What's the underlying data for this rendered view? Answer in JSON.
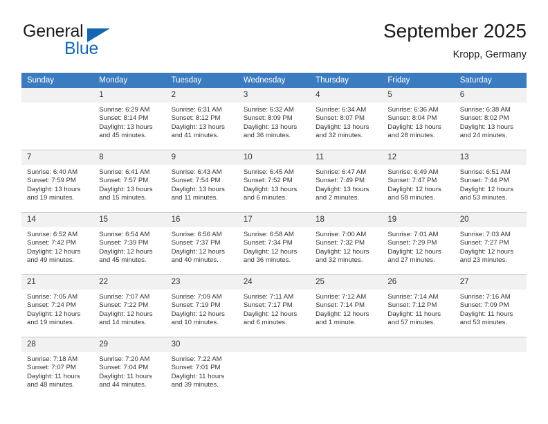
{
  "brand": {
    "name_part1": "General",
    "name_part2": "Blue",
    "accent_color": "#1567b2"
  },
  "header": {
    "title": "September 2025",
    "subtitle": "Kropp, Germany",
    "header_bg_color": "#3b7cc0"
  },
  "weekday_headers": [
    "Sunday",
    "Monday",
    "Tuesday",
    "Wednesday",
    "Thursday",
    "Friday",
    "Saturday"
  ],
  "labels": {
    "sunrise_prefix": "Sunrise:",
    "sunset_prefix": "Sunset:",
    "daylight_prefix": "Daylight:"
  },
  "weeks": [
    [
      {
        "day": "",
        "line1": "",
        "line2": "",
        "line3": "",
        "line4": "",
        "blank": true
      },
      {
        "day": "1",
        "line1": "Sunrise: 6:29 AM",
        "line2": "Sunset: 8:14 PM",
        "line3": "Daylight: 13 hours",
        "line4": "and 45 minutes."
      },
      {
        "day": "2",
        "line1": "Sunrise: 6:31 AM",
        "line2": "Sunset: 8:12 PM",
        "line3": "Daylight: 13 hours",
        "line4": "and 41 minutes."
      },
      {
        "day": "3",
        "line1": "Sunrise: 6:32 AM",
        "line2": "Sunset: 8:09 PM",
        "line3": "Daylight: 13 hours",
        "line4": "and 36 minutes."
      },
      {
        "day": "4",
        "line1": "Sunrise: 6:34 AM",
        "line2": "Sunset: 8:07 PM",
        "line3": "Daylight: 13 hours",
        "line4": "and 32 minutes."
      },
      {
        "day": "5",
        "line1": "Sunrise: 6:36 AM",
        "line2": "Sunset: 8:04 PM",
        "line3": "Daylight: 13 hours",
        "line4": "and 28 minutes."
      },
      {
        "day": "6",
        "line1": "Sunrise: 6:38 AM",
        "line2": "Sunset: 8:02 PM",
        "line3": "Daylight: 13 hours",
        "line4": "and 24 minutes."
      }
    ],
    [
      {
        "day": "7",
        "line1": "Sunrise: 6:40 AM",
        "line2": "Sunset: 7:59 PM",
        "line3": "Daylight: 13 hours",
        "line4": "and 19 minutes."
      },
      {
        "day": "8",
        "line1": "Sunrise: 6:41 AM",
        "line2": "Sunset: 7:57 PM",
        "line3": "Daylight: 13 hours",
        "line4": "and 15 minutes."
      },
      {
        "day": "9",
        "line1": "Sunrise: 6:43 AM",
        "line2": "Sunset: 7:54 PM",
        "line3": "Daylight: 13 hours",
        "line4": "and 11 minutes."
      },
      {
        "day": "10",
        "line1": "Sunrise: 6:45 AM",
        "line2": "Sunset: 7:52 PM",
        "line3": "Daylight: 13 hours",
        "line4": "and 6 minutes."
      },
      {
        "day": "11",
        "line1": "Sunrise: 6:47 AM",
        "line2": "Sunset: 7:49 PM",
        "line3": "Daylight: 13 hours",
        "line4": "and 2 minutes."
      },
      {
        "day": "12",
        "line1": "Sunrise: 6:49 AM",
        "line2": "Sunset: 7:47 PM",
        "line3": "Daylight: 12 hours",
        "line4": "and 58 minutes."
      },
      {
        "day": "13",
        "line1": "Sunrise: 6:51 AM",
        "line2": "Sunset: 7:44 PM",
        "line3": "Daylight: 12 hours",
        "line4": "and 53 minutes."
      }
    ],
    [
      {
        "day": "14",
        "line1": "Sunrise: 6:52 AM",
        "line2": "Sunset: 7:42 PM",
        "line3": "Daylight: 12 hours",
        "line4": "and 49 minutes."
      },
      {
        "day": "15",
        "line1": "Sunrise: 6:54 AM",
        "line2": "Sunset: 7:39 PM",
        "line3": "Daylight: 12 hours",
        "line4": "and 45 minutes."
      },
      {
        "day": "16",
        "line1": "Sunrise: 6:56 AM",
        "line2": "Sunset: 7:37 PM",
        "line3": "Daylight: 12 hours",
        "line4": "and 40 minutes."
      },
      {
        "day": "17",
        "line1": "Sunrise: 6:58 AM",
        "line2": "Sunset: 7:34 PM",
        "line3": "Daylight: 12 hours",
        "line4": "and 36 minutes."
      },
      {
        "day": "18",
        "line1": "Sunrise: 7:00 AM",
        "line2": "Sunset: 7:32 PM",
        "line3": "Daylight: 12 hours",
        "line4": "and 32 minutes."
      },
      {
        "day": "19",
        "line1": "Sunrise: 7:01 AM",
        "line2": "Sunset: 7:29 PM",
        "line3": "Daylight: 12 hours",
        "line4": "and 27 minutes."
      },
      {
        "day": "20",
        "line1": "Sunrise: 7:03 AM",
        "line2": "Sunset: 7:27 PM",
        "line3": "Daylight: 12 hours",
        "line4": "and 23 minutes."
      }
    ],
    [
      {
        "day": "21",
        "line1": "Sunrise: 7:05 AM",
        "line2": "Sunset: 7:24 PM",
        "line3": "Daylight: 12 hours",
        "line4": "and 19 minutes."
      },
      {
        "day": "22",
        "line1": "Sunrise: 7:07 AM",
        "line2": "Sunset: 7:22 PM",
        "line3": "Daylight: 12 hours",
        "line4": "and 14 minutes."
      },
      {
        "day": "23",
        "line1": "Sunrise: 7:09 AM",
        "line2": "Sunset: 7:19 PM",
        "line3": "Daylight: 12 hours",
        "line4": "and 10 minutes."
      },
      {
        "day": "24",
        "line1": "Sunrise: 7:11 AM",
        "line2": "Sunset: 7:17 PM",
        "line3": "Daylight: 12 hours",
        "line4": "and 6 minutes."
      },
      {
        "day": "25",
        "line1": "Sunrise: 7:12 AM",
        "line2": "Sunset: 7:14 PM",
        "line3": "Daylight: 12 hours",
        "line4": "and 1 minute."
      },
      {
        "day": "26",
        "line1": "Sunrise: 7:14 AM",
        "line2": "Sunset: 7:12 PM",
        "line3": "Daylight: 11 hours",
        "line4": "and 57 minutes."
      },
      {
        "day": "27",
        "line1": "Sunrise: 7:16 AM",
        "line2": "Sunset: 7:09 PM",
        "line3": "Daylight: 11 hours",
        "line4": "and 53 minutes."
      }
    ],
    [
      {
        "day": "28",
        "line1": "Sunrise: 7:18 AM",
        "line2": "Sunset: 7:07 PM",
        "line3": "Daylight: 11 hours",
        "line4": "and 48 minutes."
      },
      {
        "day": "29",
        "line1": "Sunrise: 7:20 AM",
        "line2": "Sunset: 7:04 PM",
        "line3": "Daylight: 11 hours",
        "line4": "and 44 minutes."
      },
      {
        "day": "30",
        "line1": "Sunrise: 7:22 AM",
        "line2": "Sunset: 7:01 PM",
        "line3": "Daylight: 11 hours",
        "line4": "and 39 minutes."
      },
      {
        "day": "",
        "line1": "",
        "line2": "",
        "line3": "",
        "line4": "",
        "blank": true
      },
      {
        "day": "",
        "line1": "",
        "line2": "",
        "line3": "",
        "line4": "",
        "blank": true
      },
      {
        "day": "",
        "line1": "",
        "line2": "",
        "line3": "",
        "line4": "",
        "blank": true
      },
      {
        "day": "",
        "line1": "",
        "line2": "",
        "line3": "",
        "line4": "",
        "blank": true
      }
    ]
  ]
}
